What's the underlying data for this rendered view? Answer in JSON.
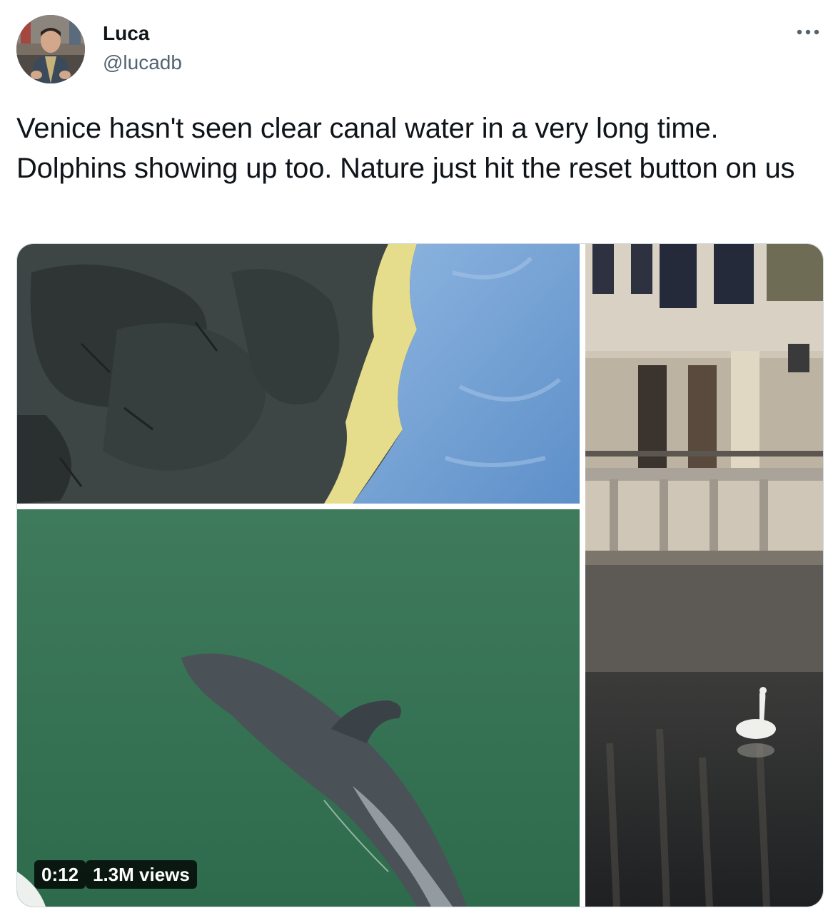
{
  "tweet": {
    "author": {
      "display_name": "Luca",
      "handle": "@lucadb",
      "avatar_icon": "user-avatar-photo"
    },
    "more_icon": "ellipsis-icon",
    "text": "Venice hasn't seen clear canal water in a very long time. Dolphins showing up too. Nature just hit the reset button on us",
    "media": {
      "type": "video",
      "duration": "0:12",
      "views": "1.3M views",
      "panels": [
        "clear-canal-water",
        "dolphin-fin",
        "canal-swan"
      ]
    }
  },
  "colors": {
    "text_primary": "#0f1419",
    "text_secondary": "#536471",
    "border": "#cfd9de"
  }
}
